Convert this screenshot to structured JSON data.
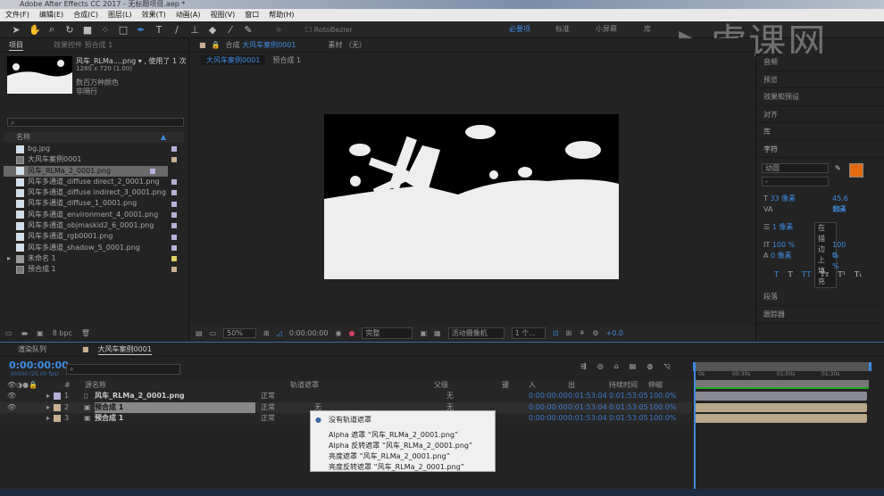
{
  "window": {
    "title": "Adobe After Effects CC 2017 - 无标题项目.aep *"
  },
  "menu": [
    "文件(F)",
    "编辑(E)",
    "合成(C)",
    "图层(L)",
    "效果(T)",
    "动画(A)",
    "视图(V)",
    "窗口",
    "帮助(H)"
  ],
  "toolbar": {
    "rotobezier": "RotoBezier",
    "workspaces": [
      "必要项",
      "标准",
      "小屏幕",
      "库"
    ],
    "active_workspace": "必要项"
  },
  "watermark": "虎课网",
  "project": {
    "tabs": [
      "项目",
      "效果控件 预合成 1"
    ],
    "selected_name": "风车_RLMa....png ▾ , 使用了 1 次",
    "dims": "1280 x 720 (1.00)",
    "colors": "数百万种颜色",
    "interlace": "非隔行",
    "column_name": "名称",
    "bpc": "8 bpc",
    "items": [
      {
        "name": "bg.jpg",
        "type": "file",
        "color": "#b8b0d8"
      },
      {
        "name": "大风车案例0001",
        "type": "comp",
        "color": "#c8b090"
      },
      {
        "name": "风车_RLMa_2_0001.png",
        "type": "file",
        "color": "#b8b0d8",
        "selected": true
      },
      {
        "name": "风车多通道_diffuse direct_2_0001.png",
        "type": "file",
        "color": "#b8b0d8"
      },
      {
        "name": "风车多通道_diffuse indirect_3_0001.png",
        "type": "file",
        "color": "#b8b0d8"
      },
      {
        "name": "风车多通道_diffuse_1_0001.png",
        "type": "file",
        "color": "#b8b0d8"
      },
      {
        "name": "风车多通道_environment_4_0001.png",
        "type": "file",
        "color": "#b8b0d8"
      },
      {
        "name": "风车多通道_objmaskid2_6_0001.png",
        "type": "file",
        "color": "#b8b0d8"
      },
      {
        "name": "风车多通道_rgb0001.png",
        "type": "file",
        "color": "#b8b0d8"
      },
      {
        "name": "风车多通道_shadow_5_0001.png",
        "type": "file",
        "color": "#b8b0d8"
      },
      {
        "name": "未命名 1",
        "type": "folder",
        "color": "#e0d060"
      },
      {
        "name": "预合成 1",
        "type": "comp",
        "color": "#c8b090"
      }
    ]
  },
  "composition": {
    "tab_prefix": "合成",
    "tab_name": "大风车案例0001",
    "footage_tab": "素材 （无）",
    "breadcrumbs": [
      "大风车案例0001",
      "预合成 1"
    ],
    "footer": {
      "zoom": "50%",
      "time": "0:00:00:00",
      "resolution": "完整",
      "camera": "活动摄像机",
      "views": "1 个...",
      "exposure": "+0.0"
    }
  },
  "right": {
    "panels": [
      "音频",
      "预览",
      "效果和预设",
      "对齐",
      "库"
    ],
    "character": {
      "title": "字符",
      "font": "幼圆",
      "style": "-",
      "size": "33 像素",
      "leading": "45.6 像素",
      "tracking": "114",
      "stroke": "1 像素",
      "stroke_mode": "在描边上填充",
      "vscale": "100 %",
      "hscale": "100 %",
      "baseline": "0 像素",
      "tsume": "0 %",
      "fill_color": "#e06b10",
      "styles": [
        "T",
        "T",
        "TT",
        "Tт",
        "T¹",
        "T₁"
      ]
    },
    "bottom_panels": [
      "段落",
      "跟踪器"
    ]
  },
  "timeline": {
    "tabs": [
      "渲染队列",
      "大风车案例0001"
    ],
    "timecode": "0:00:00:00",
    "fps": "00000 (25.00 fps)",
    "headers": {
      "num": "#",
      "source": "源名称",
      "trackmatte": "轨道遮罩",
      "parent": "父级",
      "key": "键",
      "in": "入",
      "out": "出",
      "duration": "持续时间",
      "stretch": "伸缩"
    },
    "ruler": [
      "0s",
      "00:30s",
      "01:00s",
      "01:30s"
    ],
    "layers": [
      {
        "num": "1",
        "name": "风车_RLMa_2_0001.png",
        "mode": "正常",
        "matte": "",
        "parent": "无",
        "in": "0:00:00:00",
        "out": "0:01:53:04",
        "duration": "0:01:53:05",
        "stretch": "100.0%",
        "color": "#b8b0d8"
      },
      {
        "num": "2",
        "name": "预合成 1",
        "mode": "正常",
        "matte": "无",
        "parent": "无",
        "in": "0:00:00:00",
        "out": "0:01:53:04",
        "duration": "0:01:53:05",
        "stretch": "100.0%",
        "color": "#c8b090"
      },
      {
        "num": "3",
        "name": "预合成 1",
        "mode": "正常",
        "matte": "",
        "parent": "",
        "in": "0:00:00:00",
        "out": "0:01:53:04",
        "duration": "0:01:53:05",
        "stretch": "100.0%",
        "color": "#c8b090"
      }
    ],
    "matte_menu": [
      "没有轨道遮罩",
      "Alpha 遮罩 “风车_RLMa_2_0001.png”",
      "Alpha 反转遮罩 “风车_RLMa_2_0001.png”",
      "亮度遮罩 “风车_RLMa_2_0001.png”",
      "亮度反转遮罩 “风车_RLMa_2_0001.png”"
    ]
  }
}
